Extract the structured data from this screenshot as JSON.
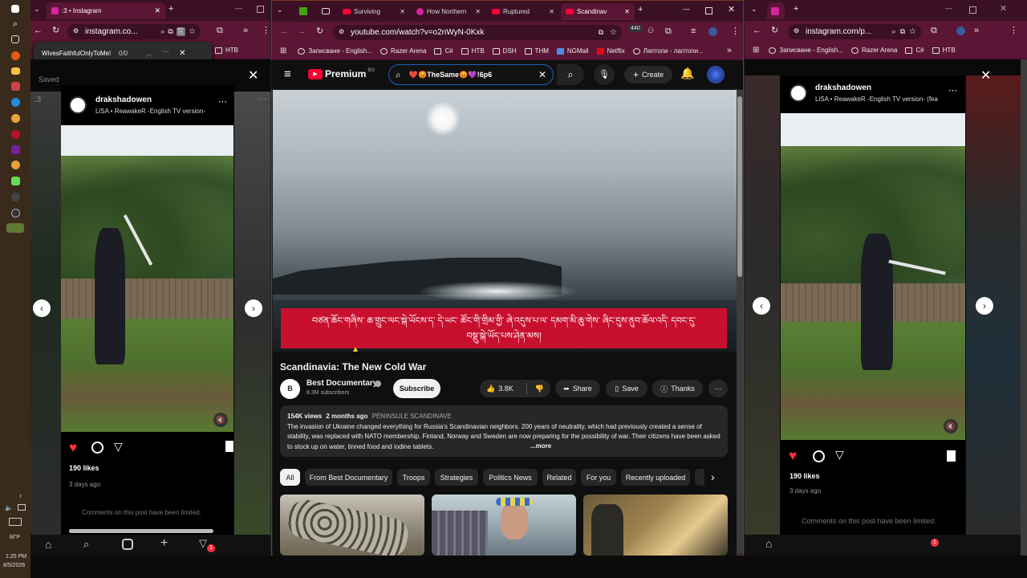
{
  "taskbar": {
    "time": "1:25 PM",
    "date": "8/5/2026",
    "lang": "БГР"
  },
  "left_window": {
    "tab_title": ":3 • Instagram",
    "url": "instagram.co...",
    "find_query": "WivesFaithfulOnlyToMe!",
    "find_count": "0/0",
    "bookmark_htb": "HTB",
    "saved_label": "Saved",
    "post": {
      "username": "drakshadowen",
      "music": "LiSA • ReawakeR -English TV version-",
      "likes": "190 likes",
      "date": "3 days ago",
      "comments_limited": "Comments on this post have been limited."
    },
    "num_label": ":3"
  },
  "center_window": {
    "tabs": [
      "Surviving",
      "How Northern",
      "Ruptured",
      "Scandinav"
    ],
    "url": "youtube.com/watch?v=o2nWyN-0Kxk",
    "ext_badge": "440",
    "bookmarks": [
      "Записване - English...",
      "Razer Arena",
      "C#",
      "HTB",
      "DSH",
      "THM",
      "NGMail",
      "Netflix",
      "Лаптопи - лаптопи..."
    ],
    "youtube": {
      "brand": "Premium",
      "region": "BG",
      "search_value": "❤️😡TheSame😡💜!6р6",
      "create_label": "Create",
      "subtitle_line1": "བཙན་ཆོང་གཞིས་ ཆ་གྲུང་ལང་སྐེ་ཡོངས་ད་ དེ་ཡང་ ཚོང་གི་གྲིམ་གྱི་ ཞེ་འདུས་པ་ལ་ དམག་མི་ཆུ་གེས་ ཞིང་དུས་ནུབ་ཆོལ་འདི་ དབང་དུ་",
      "subtitle_line2": "བསྡུ་སྐེ་ཡོད་པས་ཤེན་མས།",
      "video_title": "Scandinavia: The New Cold War",
      "channel": "Best Documentary",
      "subscribers": "8.3M subscribers",
      "subscribe_label": "Subscribe",
      "likes": "3.8K",
      "share_label": "Share",
      "save_label": "Save",
      "thanks_label": "Thanks",
      "views": "154K views",
      "age": "2 months ago",
      "tag": "PÉNINSULE SCANDINAVE",
      "description": "The invasion of Ukraine changed everything for Russia's Scandinavian neighbors. 200 years of neutrality, which had previously created a sense of stability, was replaced with NATO membership. Finland, Norway and Sweden are now preparing for the possibility of war. Their citizens have been asked to stock up on water, tinned food and iodine tablets.",
      "more_label": "...more",
      "chips": [
        "All",
        "From Best Documentary",
        "Troops",
        "Strategies",
        "Politics News",
        "Related",
        "For you",
        "Recently uploaded"
      ]
    }
  },
  "right_window": {
    "url": "instagram.com/p...",
    "bookmarks": [
      "Записване - English...",
      "Razer Arena",
      "C#",
      "HTB"
    ],
    "post": {
      "username": "drakshadowen",
      "music": "LiSA • ReawakeR -English TV version- (fea",
      "likes": "190 likes",
      "date": "3 days ago",
      "comments_limited": "Comments on this post have been limited."
    }
  },
  "colors": {
    "chrome_dark": "#3b0f24",
    "chrome": "#5a1634",
    "yt_bg": "#0f0f0f",
    "like_red": "#ff3040",
    "subtitle_red": "#c8102e"
  },
  "notifications": {
    "dm_badge": "1"
  }
}
